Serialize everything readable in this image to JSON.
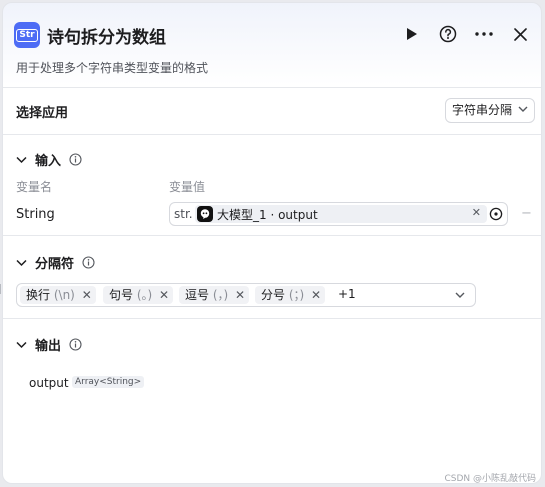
{
  "header": {
    "title": "诗句拆分为数组",
    "subtitle": "用于处理多个字符串类型变量的格式",
    "app_icon_text": "Str"
  },
  "icons": {
    "app": "string-node-icon",
    "run": "play-icon",
    "help": "help-circle-icon",
    "more": "more-horizontal-icon",
    "close": "close-icon",
    "info": "info-circle-icon",
    "collapse": "chevron-down-icon",
    "model": "llm-model-icon",
    "target": "target-icon"
  },
  "select_app": {
    "label": "选择应用",
    "value": "字符串分隔"
  },
  "input": {
    "section_title": "输入",
    "col_name": "变量名",
    "col_value": "变量值",
    "var_name": "String",
    "type_prefix": "str.",
    "ref_text": "大模型_1 · output",
    "remove_label": "−"
  },
  "separators": {
    "section_title": "分隔符",
    "chips": [
      {
        "label": "换行",
        "symbol": "(\\n)"
      },
      {
        "label": "句号",
        "symbol": "(。)"
      },
      {
        "label": "逗号",
        "symbol": "(，)"
      },
      {
        "label": "分号",
        "symbol": "(；)"
      }
    ],
    "more": "+1"
  },
  "output": {
    "section_title": "输出",
    "var_name": "output",
    "type": "Array<String>"
  },
  "watermark": "CSDN @小陈乱敲代码",
  "colors": {
    "accent": "#4d6cf5",
    "border": "#d7d9de",
    "muted": "#8a8d95"
  }
}
